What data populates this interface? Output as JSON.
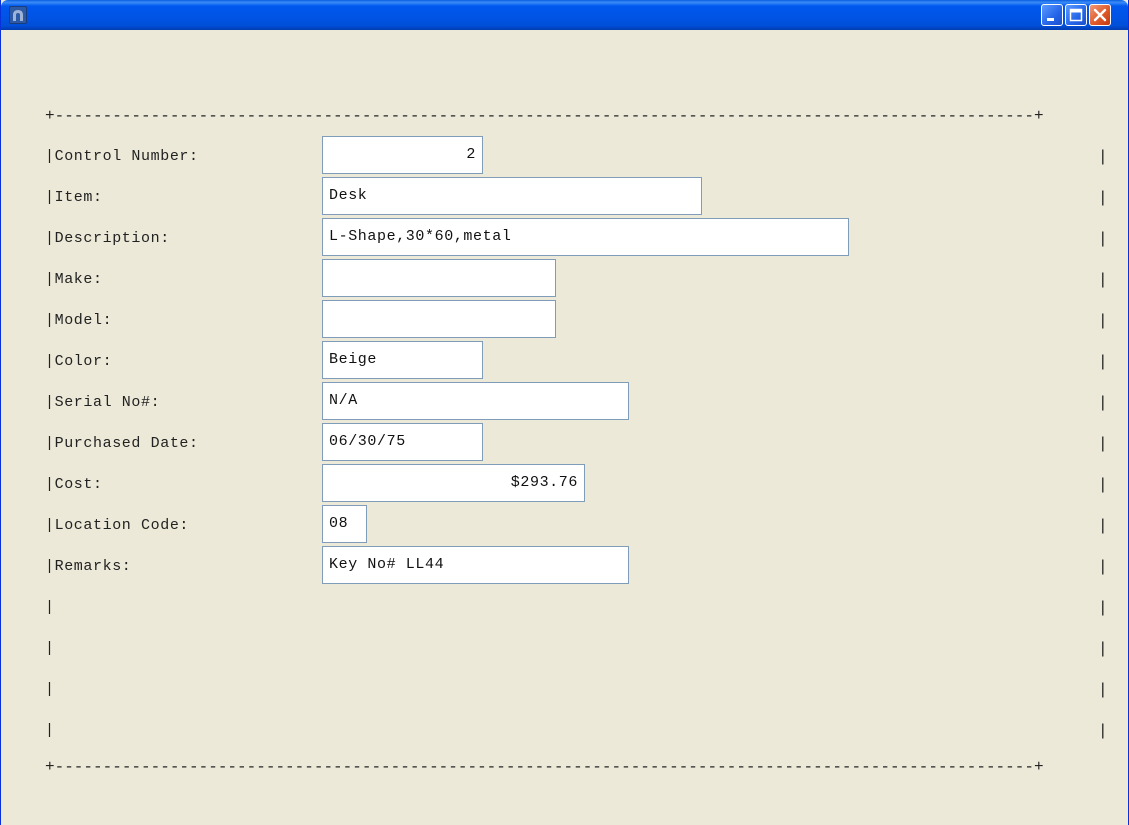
{
  "window": {
    "border_top": "+------------------------------------------------------------------------------------------------------+",
    "border_bottom": "+------------------------------------------------------------------------------------------------------+",
    "pipe": "|"
  },
  "form": {
    "fields": [
      {
        "label": "|Control Number:",
        "value": "2"
      },
      {
        "label": "|Item:",
        "value": "Desk"
      },
      {
        "label": "|Description:",
        "value": "L-Shape,30*60,metal"
      },
      {
        "label": "|Make:",
        "value": ""
      },
      {
        "label": "|Model:",
        "value": ""
      },
      {
        "label": "|Color:",
        "value": "Beige"
      },
      {
        "label": "|Serial No#:",
        "value": "N/A"
      },
      {
        "label": "|Purchased Date:",
        "value": "06/30/75"
      },
      {
        "label": "|Cost:",
        "value": "$293.76"
      },
      {
        "label": "|Location Code:",
        "value": "08"
      },
      {
        "label": "|Remarks:",
        "value": "Key No# LL44"
      }
    ],
    "empty_rows": [
      "|",
      "|",
      "|",
      "|"
    ]
  },
  "colors": {
    "background": "#ece9d8",
    "titlebar": "#0053e4",
    "field_border": "#7f9db9"
  },
  "icons": {
    "app": "app-icon",
    "minimize": "minimize-icon",
    "maximize": "maximize-icon",
    "close": "close-icon"
  }
}
